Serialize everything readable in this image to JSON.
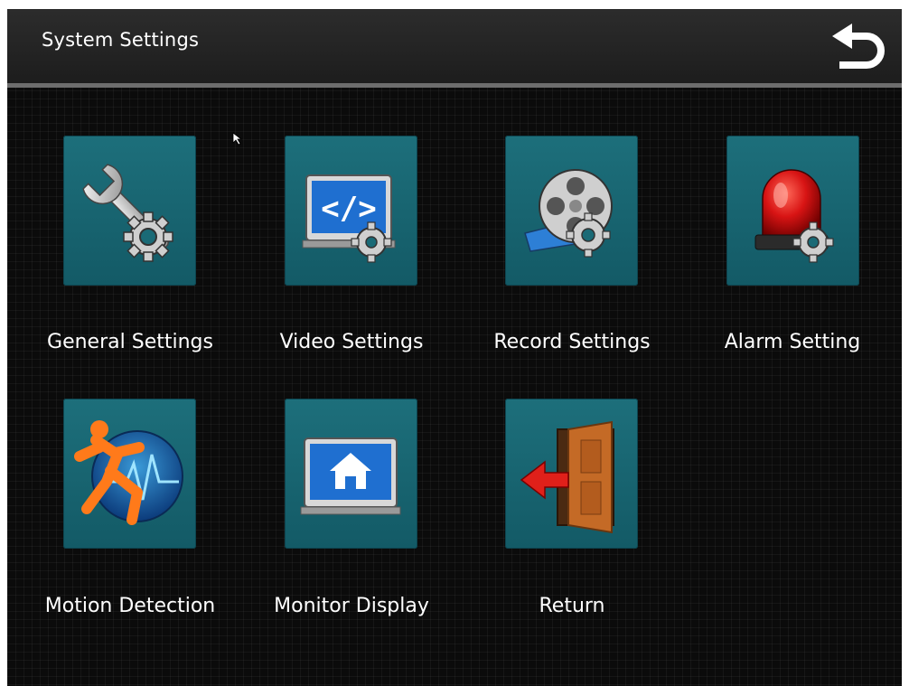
{
  "header": {
    "title": "System Settings",
    "back_icon": "undo-arrow-icon"
  },
  "menu": {
    "items": [
      {
        "label": "General Settings",
        "icon": "wrench-gear-icon"
      },
      {
        "label": "Video Settings",
        "icon": "video-code-gear-icon"
      },
      {
        "label": "Record Settings",
        "icon": "film-reel-gear-icon"
      },
      {
        "label": "Alarm Setting",
        "icon": "siren-gear-icon"
      },
      {
        "label": "Motion Detection",
        "icon": "running-man-icon"
      },
      {
        "label": "Monitor Display",
        "icon": "monitor-home-icon"
      },
      {
        "label": "Return",
        "icon": "exit-door-icon"
      }
    ]
  },
  "colors": {
    "tile": "#1a6a76",
    "background": "#0b0b0b",
    "header": "#262626"
  }
}
